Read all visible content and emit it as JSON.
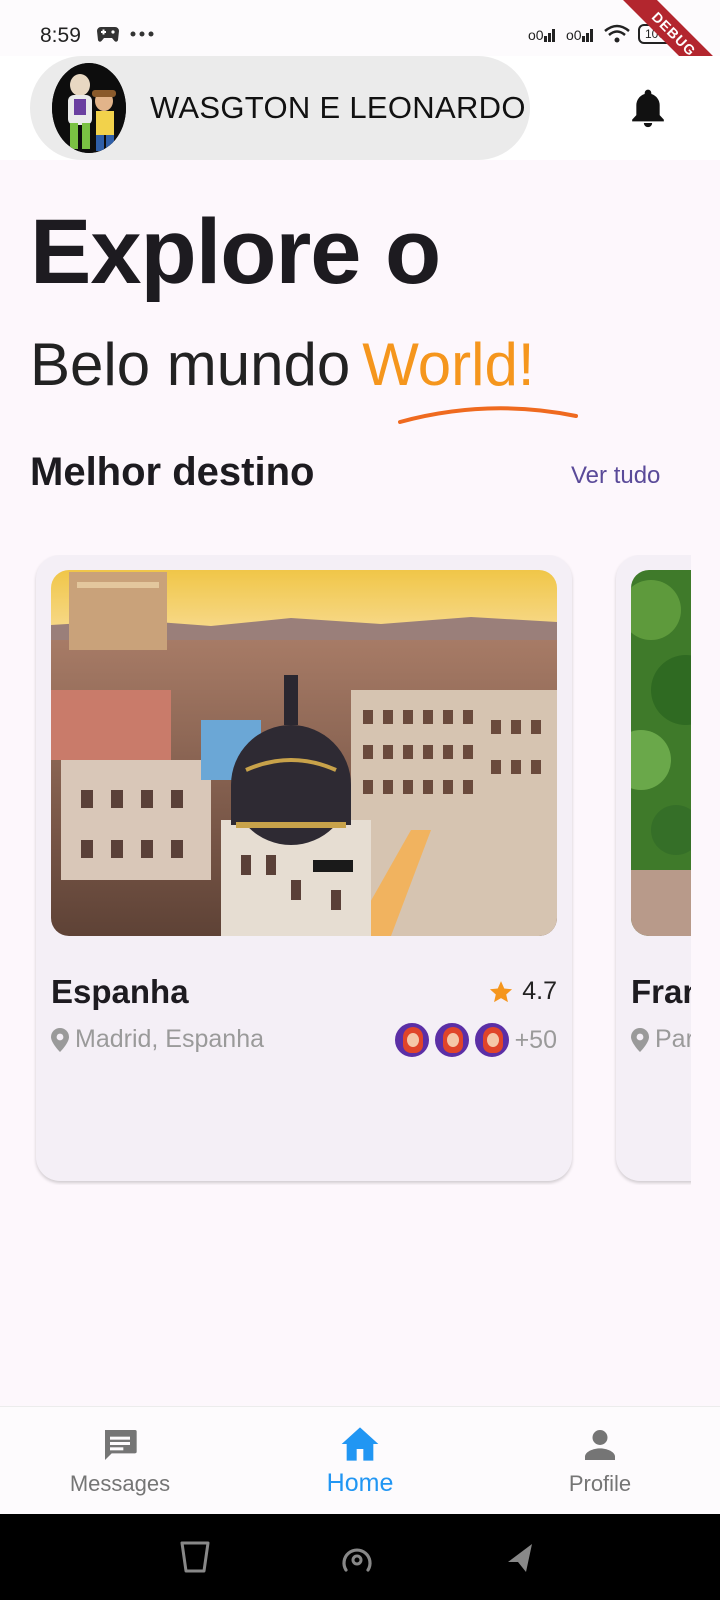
{
  "status_bar": {
    "time": "8:59",
    "battery": "100",
    "debug_label": "DEBUG"
  },
  "header": {
    "user_name": "WASGTON E LEONARDO"
  },
  "hero": {
    "title": "Explore o",
    "subtitle_plain": "Belo mundo",
    "subtitle_accent": "World!"
  },
  "section": {
    "title": "Melhor destino",
    "see_all": "Ver tudo"
  },
  "cards": [
    {
      "title": "Espanha",
      "rating": "4.7",
      "location": "Madrid, Espanha",
      "visitors_extra": "+50"
    },
    {
      "title": "França",
      "location": "Paris, França"
    }
  ],
  "bottom_nav": {
    "items": [
      {
        "label": "Messages",
        "icon": "message-icon"
      },
      {
        "label": "Home",
        "icon": "home-icon",
        "active": true
      },
      {
        "label": "Profile",
        "icon": "person-icon"
      }
    ]
  },
  "colors": {
    "accent_orange": "#f5961d",
    "link_purple": "#5a4a99",
    "active_blue": "#2196f3",
    "card_bg": "#f4eff6"
  }
}
